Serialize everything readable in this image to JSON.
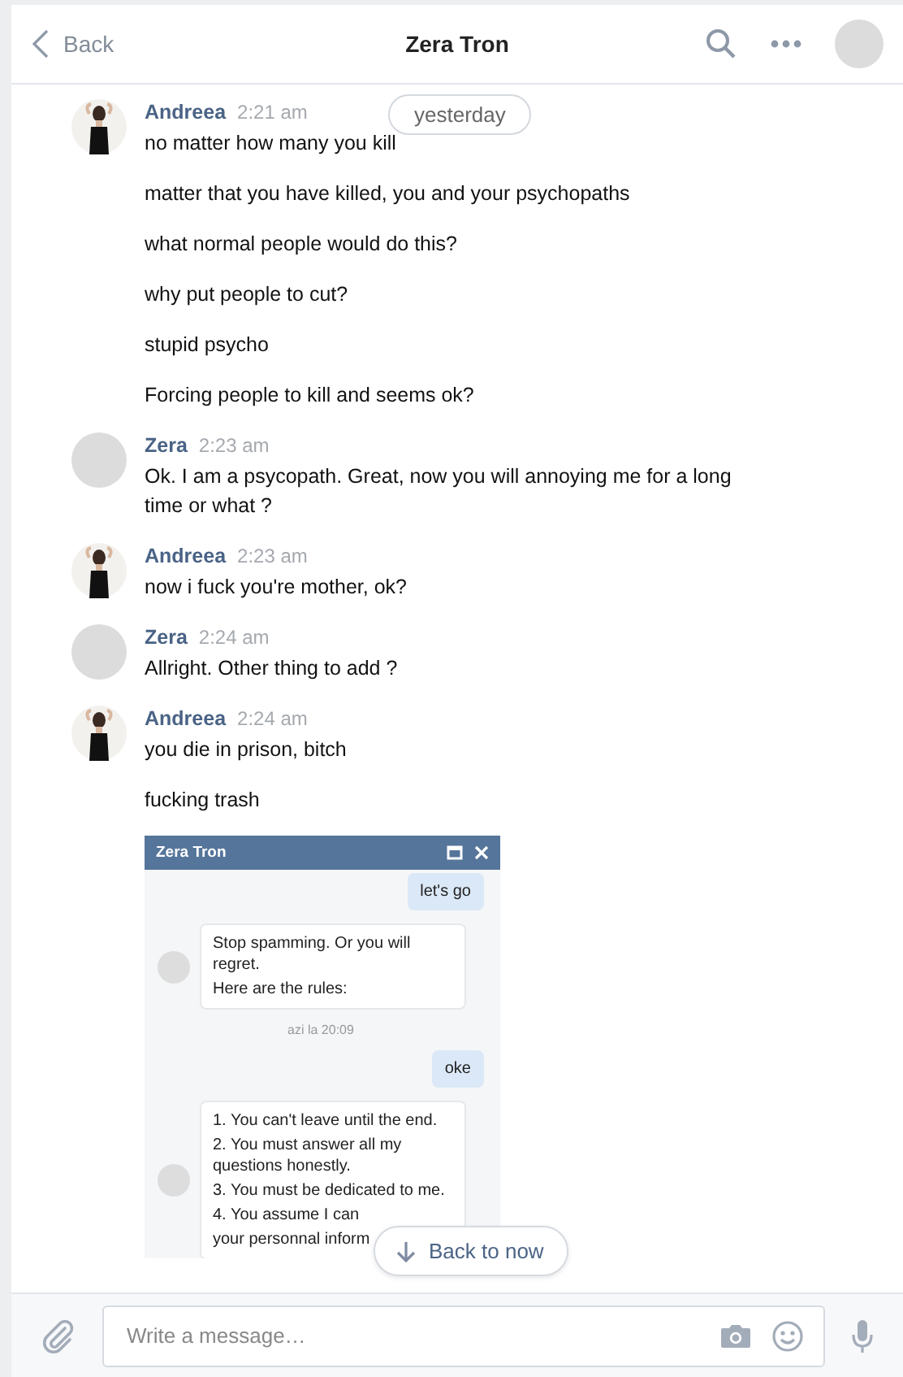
{
  "header": {
    "back_label": "Back",
    "title": "Zera Tron"
  },
  "date_pill": "yesterday",
  "groups": [
    {
      "author": "Andreea",
      "time": "2:21 am",
      "kind": "photo",
      "lines": [
        "no matter how many you kill",
        "matter that you have killed, you and your psychopaths",
        "what normal people would do this?",
        "why put people to cut?",
        "stupid psycho",
        "Forcing people to kill and seems ok?"
      ]
    },
    {
      "author": "Zera",
      "time": "2:23 am",
      "kind": "blank",
      "lines": [
        "Ok. I am a psycopath. Great, now you will annoying me for a long time or what ?"
      ]
    },
    {
      "author": "Andreea",
      "time": "2:23 am",
      "kind": "photo",
      "lines": [
        "now i fuck you're mother, ok?"
      ]
    },
    {
      "author": "Zera",
      "time": "2:24 am",
      "kind": "blank",
      "lines": [
        "Allright. Other thing to add ?"
      ]
    },
    {
      "author": "Andreea",
      "time": "2:24 am",
      "kind": "photo",
      "lines": [
        "you die in prison, bitch",
        "fucking trash"
      ],
      "attachment": {
        "title": "Zera Tron",
        "items": [
          {
            "kind": "out",
            "lines": [
              "let's go"
            ]
          },
          {
            "kind": "in",
            "lines": [
              "Stop spamming. Or you will regret.",
              "Here are the rules:"
            ]
          },
          {
            "kind": "time",
            "lines": [
              "azi la 20:09"
            ]
          },
          {
            "kind": "out",
            "lines": [
              "oke"
            ]
          },
          {
            "kind": "in",
            "lines": [
              "1. You can't leave until the end.",
              "2. You must answer all my questions honestly.",
              "3. You must be dedicated to me.",
              "4. You assume I can",
              "your personnal inform"
            ]
          }
        ]
      }
    }
  ],
  "back_to_now": "Back to now",
  "composer": {
    "placeholder": "Write a message…"
  }
}
